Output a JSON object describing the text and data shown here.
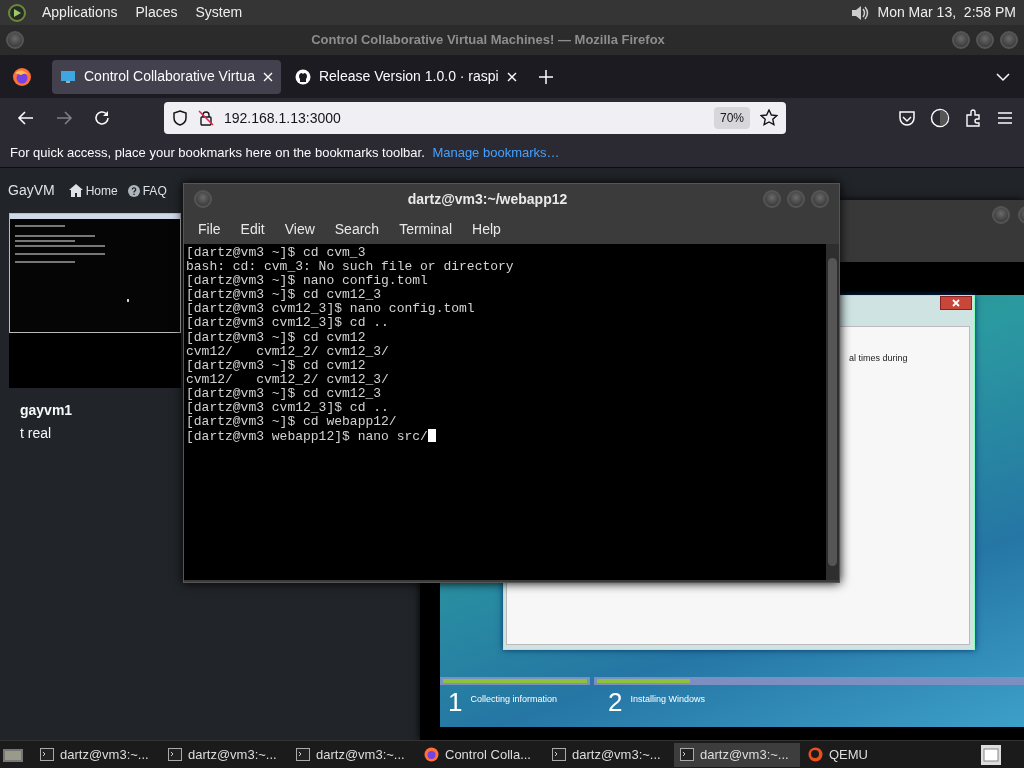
{
  "top_panel": {
    "menus": [
      "Applications",
      "Places",
      "System"
    ],
    "clock": "Mon Mar 13,  2:58 PM"
  },
  "browser": {
    "window_title": "Control Collaborative Virtual Machines! — Mozilla Firefox",
    "tabs": [
      {
        "label": "Control Collaborative Virtua",
        "kind": "monitor",
        "selected": true
      },
      {
        "label": "Release Version 1.0.0 · raspi",
        "kind": "github",
        "selected": false
      }
    ],
    "back_disabled": false,
    "forward_disabled": true,
    "url": "192.168.1.13:3000",
    "zoom": "70%",
    "bookmarks_hint": "For quick access, place your bookmarks here on the bookmarks toolbar.",
    "bookmarks_link": "Manage bookmarks…"
  },
  "site": {
    "brand": "GayVM",
    "nav": [
      {
        "label": "Home",
        "kind": "home"
      },
      {
        "label": "FAQ",
        "kind": "help"
      }
    ],
    "vm_card": {
      "name": "gayvm1",
      "description": "t real"
    }
  },
  "terminal": {
    "title": "dartz@vm3:~/webapp12",
    "menu": [
      "File",
      "Edit",
      "View",
      "Search",
      "Terminal",
      "Help"
    ],
    "lines": [
      "[dartz@vm3 ~]$ cd cvm_3",
      "bash: cd: cvm_3: No such file or directory",
      "[dartz@vm3 ~]$ nano config.toml",
      "[dartz@vm3 ~]$ cd cvm12_3",
      "[dartz@vm3 cvm12_3]$ nano config.toml",
      "[dartz@vm3 cvm12_3]$ cd ..",
      "[dartz@vm3 ~]$ cd cvm12",
      "cvm12/   cvm12_2/ cvm12_3/",
      "[dartz@vm3 ~]$ cd cvm12",
      "cvm12/   cvm12_2/ cvm12_3/",
      "[dartz@vm3 ~]$ cd cvm12_3",
      "[dartz@vm3 cvm12_3]$ cd ..",
      "[dartz@vm3 ~]$ cd webapp12/",
      "[dartz@vm3 webapp12]$ nano src/"
    ]
  },
  "vm_screen": {
    "dialog_text": "al times during",
    "steps": [
      {
        "number": "1",
        "label": "Collecting information",
        "level": 1
      },
      {
        "number": "2",
        "label": "Installing Windows",
        "level": 0.22
      }
    ]
  },
  "taskbar": {
    "items": [
      {
        "label": "dartz@vm3:~...",
        "kind": "terminal",
        "selected": false
      },
      {
        "label": "dartz@vm3:~...",
        "kind": "terminal",
        "selected": false
      },
      {
        "label": "dartz@vm3:~...",
        "kind": "terminal",
        "selected": false
      },
      {
        "label": "Control Colla...",
        "kind": "firefox",
        "selected": false
      },
      {
        "label": "dartz@vm3:~...",
        "kind": "terminal",
        "selected": false
      },
      {
        "label": "dartz@vm3:~...",
        "kind": "terminal",
        "selected": true
      },
      {
        "label": "QEMU",
        "kind": "qemu",
        "selected": false
      }
    ]
  }
}
